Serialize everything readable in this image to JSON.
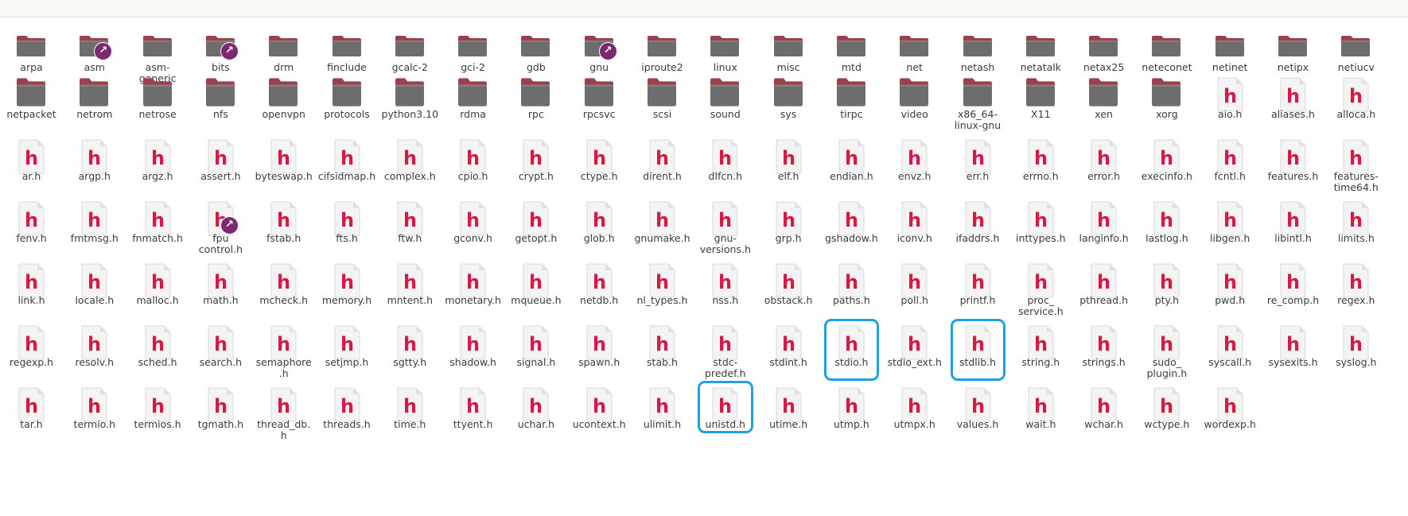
{
  "colors": {
    "folder_body": "#6d6d6d",
    "folder_tab": "#9c4050",
    "header_glyph": "#d41a45",
    "symlink_badge": "#7b2a72",
    "selection": "#1ea0e4"
  },
  "rows": [
    [
      {
        "name": "arpa",
        "type": "folder"
      },
      {
        "name": "asm",
        "type": "folder",
        "link": true
      },
      {
        "name": "asm-\ngeneric",
        "type": "folder"
      },
      {
        "name": "bits",
        "type": "folder",
        "link": true
      },
      {
        "name": "drm",
        "type": "folder"
      },
      {
        "name": "finclude",
        "type": "folder"
      },
      {
        "name": "gcalc-2",
        "type": "folder"
      },
      {
        "name": "gci-2",
        "type": "folder"
      },
      {
        "name": "gdb",
        "type": "folder"
      },
      {
        "name": "gnu",
        "type": "folder",
        "link": true
      },
      {
        "name": "iproute2",
        "type": "folder"
      },
      {
        "name": "linux",
        "type": "folder"
      },
      {
        "name": "misc",
        "type": "folder"
      },
      {
        "name": "mtd",
        "type": "folder"
      },
      {
        "name": "net",
        "type": "folder"
      },
      {
        "name": "netash",
        "type": "folder"
      },
      {
        "name": "netatalk",
        "type": "folder"
      },
      {
        "name": "netax25",
        "type": "folder"
      },
      {
        "name": "neteconet",
        "type": "folder"
      },
      {
        "name": "netinet",
        "type": "folder"
      },
      {
        "name": "netipx",
        "type": "folder"
      },
      {
        "name": "netiucv",
        "type": "folder"
      }
    ],
    [
      {
        "name": "netpacket",
        "type": "folder"
      },
      {
        "name": "netrom",
        "type": "folder"
      },
      {
        "name": "netrose",
        "type": "folder"
      },
      {
        "name": "nfs",
        "type": "folder"
      },
      {
        "name": "openvpn",
        "type": "folder"
      },
      {
        "name": "protocols",
        "type": "folder"
      },
      {
        "name": "python3.10",
        "type": "folder"
      },
      {
        "name": "rdma",
        "type": "folder"
      },
      {
        "name": "rpc",
        "type": "folder"
      },
      {
        "name": "rpcsvc",
        "type": "folder"
      },
      {
        "name": "scsi",
        "type": "folder"
      },
      {
        "name": "sound",
        "type": "folder"
      },
      {
        "name": "sys",
        "type": "folder"
      },
      {
        "name": "tirpc",
        "type": "folder"
      },
      {
        "name": "video",
        "type": "folder"
      },
      {
        "name": "x86_64-\nlinux-gnu",
        "type": "folder"
      },
      {
        "name": "X11",
        "type": "folder"
      },
      {
        "name": "xen",
        "type": "folder"
      },
      {
        "name": "xorg",
        "type": "folder"
      },
      {
        "name": "aio.h",
        "type": "file"
      },
      {
        "name": "aliases.h",
        "type": "file"
      },
      {
        "name": "alloca.h",
        "type": "file"
      }
    ],
    [
      {
        "name": "ar.h",
        "type": "file"
      },
      {
        "name": "argp.h",
        "type": "file"
      },
      {
        "name": "argz.h",
        "type": "file"
      },
      {
        "name": "assert.h",
        "type": "file"
      },
      {
        "name": "byteswap.h",
        "type": "file"
      },
      {
        "name": "cifsidmap.h",
        "type": "file"
      },
      {
        "name": "complex.h",
        "type": "file"
      },
      {
        "name": "cpio.h",
        "type": "file"
      },
      {
        "name": "crypt.h",
        "type": "file"
      },
      {
        "name": "ctype.h",
        "type": "file"
      },
      {
        "name": "dirent.h",
        "type": "file"
      },
      {
        "name": "dlfcn.h",
        "type": "file"
      },
      {
        "name": "elf.h",
        "type": "file"
      },
      {
        "name": "endian.h",
        "type": "file"
      },
      {
        "name": "envz.h",
        "type": "file"
      },
      {
        "name": "err.h",
        "type": "file"
      },
      {
        "name": "errno.h",
        "type": "file"
      },
      {
        "name": "error.h",
        "type": "file"
      },
      {
        "name": "execinfo.h",
        "type": "file"
      },
      {
        "name": "fcntl.h",
        "type": "file"
      },
      {
        "name": "features.h",
        "type": "file"
      },
      {
        "name": "features-\ntime64.h",
        "type": "file"
      }
    ],
    [
      {
        "name": "fenv.h",
        "type": "file"
      },
      {
        "name": "fmtmsg.h",
        "type": "file"
      },
      {
        "name": "fnmatch.h",
        "type": "file"
      },
      {
        "name": "fpu\ncontrol.h",
        "type": "file",
        "link": true
      },
      {
        "name": "fstab.h",
        "type": "file"
      },
      {
        "name": "fts.h",
        "type": "file"
      },
      {
        "name": "ftw.h",
        "type": "file"
      },
      {
        "name": "gconv.h",
        "type": "file"
      },
      {
        "name": "getopt.h",
        "type": "file"
      },
      {
        "name": "glob.h",
        "type": "file"
      },
      {
        "name": "gnumake.h",
        "type": "file"
      },
      {
        "name": "gnu-\nversions.h",
        "type": "file"
      },
      {
        "name": "grp.h",
        "type": "file"
      },
      {
        "name": "gshadow.h",
        "type": "file"
      },
      {
        "name": "iconv.h",
        "type": "file"
      },
      {
        "name": "ifaddrs.h",
        "type": "file"
      },
      {
        "name": "inttypes.h",
        "type": "file"
      },
      {
        "name": "langinfo.h",
        "type": "file"
      },
      {
        "name": "lastlog.h",
        "type": "file"
      },
      {
        "name": "libgen.h",
        "type": "file"
      },
      {
        "name": "libintl.h",
        "type": "file"
      },
      {
        "name": "limits.h",
        "type": "file"
      }
    ],
    [
      {
        "name": "link.h",
        "type": "file"
      },
      {
        "name": "locale.h",
        "type": "file"
      },
      {
        "name": "malloc.h",
        "type": "file"
      },
      {
        "name": "math.h",
        "type": "file"
      },
      {
        "name": "mcheck.h",
        "type": "file"
      },
      {
        "name": "memory.h",
        "type": "file"
      },
      {
        "name": "mntent.h",
        "type": "file"
      },
      {
        "name": "monetary.h",
        "type": "file"
      },
      {
        "name": "mqueue.h",
        "type": "file"
      },
      {
        "name": "netdb.h",
        "type": "file"
      },
      {
        "name": "nl_types.h",
        "type": "file"
      },
      {
        "name": "nss.h",
        "type": "file"
      },
      {
        "name": "obstack.h",
        "type": "file"
      },
      {
        "name": "paths.h",
        "type": "file"
      },
      {
        "name": "poll.h",
        "type": "file"
      },
      {
        "name": "printf.h",
        "type": "file"
      },
      {
        "name": "proc_\nservice.h",
        "type": "file"
      },
      {
        "name": "pthread.h",
        "type": "file"
      },
      {
        "name": "pty.h",
        "type": "file"
      },
      {
        "name": "pwd.h",
        "type": "file"
      },
      {
        "name": "re_comp.h",
        "type": "file"
      },
      {
        "name": "regex.h",
        "type": "file"
      }
    ],
    [
      {
        "name": "regexp.h",
        "type": "file"
      },
      {
        "name": "resolv.h",
        "type": "file"
      },
      {
        "name": "sched.h",
        "type": "file"
      },
      {
        "name": "search.h",
        "type": "file"
      },
      {
        "name": "semaphore\n.h",
        "type": "file"
      },
      {
        "name": "setjmp.h",
        "type": "file"
      },
      {
        "name": "sgtty.h",
        "type": "file"
      },
      {
        "name": "shadow.h",
        "type": "file"
      },
      {
        "name": "signal.h",
        "type": "file"
      },
      {
        "name": "spawn.h",
        "type": "file"
      },
      {
        "name": "stab.h",
        "type": "file"
      },
      {
        "name": "stdc-\npredef.h",
        "type": "file"
      },
      {
        "name": "stdint.h",
        "type": "file"
      },
      {
        "name": "stdio.h",
        "type": "file",
        "selected": true
      },
      {
        "name": "stdio_ext.h",
        "type": "file"
      },
      {
        "name": "stdlib.h",
        "type": "file",
        "selected": true
      },
      {
        "name": "string.h",
        "type": "file"
      },
      {
        "name": "strings.h",
        "type": "file"
      },
      {
        "name": "sudo_\nplugin.h",
        "type": "file"
      },
      {
        "name": "syscall.h",
        "type": "file"
      },
      {
        "name": "sysexits.h",
        "type": "file"
      },
      {
        "name": "syslog.h",
        "type": "file"
      }
    ],
    [
      {
        "name": "tar.h",
        "type": "file"
      },
      {
        "name": "termio.h",
        "type": "file"
      },
      {
        "name": "termios.h",
        "type": "file"
      },
      {
        "name": "tgmath.h",
        "type": "file"
      },
      {
        "name": "thread_db.\nh",
        "type": "file"
      },
      {
        "name": "threads.h",
        "type": "file"
      },
      {
        "name": "time.h",
        "type": "file"
      },
      {
        "name": "ttyent.h",
        "type": "file"
      },
      {
        "name": "uchar.h",
        "type": "file"
      },
      {
        "name": "ucontext.h",
        "type": "file"
      },
      {
        "name": "ulimit.h",
        "type": "file"
      },
      {
        "name": "unistd.h",
        "type": "file",
        "selected": true
      },
      {
        "name": "utime.h",
        "type": "file"
      },
      {
        "name": "utmp.h",
        "type": "file"
      },
      {
        "name": "utmpx.h",
        "type": "file"
      },
      {
        "name": "values.h",
        "type": "file"
      },
      {
        "name": "wait.h",
        "type": "file"
      },
      {
        "name": "wchar.h",
        "type": "file"
      },
      {
        "name": "wctype.h",
        "type": "file"
      },
      {
        "name": "wordexp.h",
        "type": "file"
      }
    ]
  ]
}
